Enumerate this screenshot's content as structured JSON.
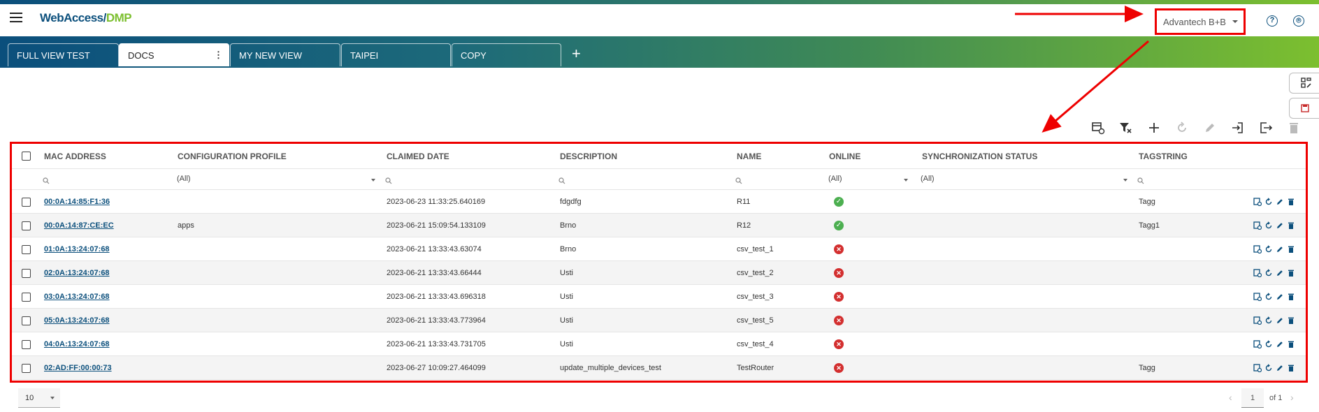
{
  "header": {
    "logo_part1": "WebAccess/",
    "logo_part2": "DMP",
    "org_selector": "Advantech B+B",
    "help_icon_glyph": "?",
    "user_icon_glyph": "⌾"
  },
  "tabs": [
    {
      "label": "FULL VIEW TEST"
    },
    {
      "label": "DOCS",
      "active": true
    },
    {
      "label": "MY NEW VIEW"
    },
    {
      "label": "TAIPEI"
    },
    {
      "label": "COPY"
    }
  ],
  "tab_add": "+",
  "tab_menu": "⋮",
  "columns": [
    "MAC ADDRESS",
    "CONFIGURATION PROFILE",
    "CLAIMED DATE",
    "DESCRIPTION",
    "NAME",
    "ONLINE",
    "SYNCHRONIZATION STATUS",
    "TAGSTRING"
  ],
  "filters": {
    "profile": "(All)",
    "online": "(All)",
    "sync": "(All)"
  },
  "rows": [
    {
      "mac": "00:0A:14:85:F1:36",
      "profile": "",
      "claimed": "2023-06-23 11:33:25.640169",
      "description": "fdgdfg",
      "name": "R11",
      "online": true,
      "sync": "",
      "tag": "Tagg"
    },
    {
      "mac": "00:0A:14:87:CE:EC",
      "profile": "apps",
      "claimed": "2023-06-21 15:09:54.133109",
      "description": "Brno",
      "name": "R12",
      "online": true,
      "sync": "",
      "tag": "Tagg1"
    },
    {
      "mac": "01:0A:13:24:07:68",
      "profile": "",
      "claimed": "2023-06-21 13:33:43.63074",
      "description": "Brno",
      "name": "csv_test_1",
      "online": false,
      "sync": "",
      "tag": ""
    },
    {
      "mac": "02:0A:13:24:07:68",
      "profile": "",
      "claimed": "2023-06-21 13:33:43.66444",
      "description": "Usti",
      "name": "csv_test_2",
      "online": false,
      "sync": "",
      "tag": ""
    },
    {
      "mac": "03:0A:13:24:07:68",
      "profile": "",
      "claimed": "2023-06-21 13:33:43.696318",
      "description": "Usti",
      "name": "csv_test_3",
      "online": false,
      "sync": "",
      "tag": ""
    },
    {
      "mac": "05:0A:13:24:07:68",
      "profile": "",
      "claimed": "2023-06-21 13:33:43.773964",
      "description": "Usti",
      "name": "csv_test_5",
      "online": false,
      "sync": "",
      "tag": ""
    },
    {
      "mac": "04:0A:13:24:07:68",
      "profile": "",
      "claimed": "2023-06-21 13:33:43.731705",
      "description": "Usti",
      "name": "csv_test_4",
      "online": false,
      "sync": "",
      "tag": ""
    },
    {
      "mac": "02:AD:FF:00:00:73",
      "profile": "",
      "claimed": "2023-06-27 10:09:27.464099",
      "description": "update_multiple_devices_test",
      "name": "TestRouter",
      "online": false,
      "sync": "",
      "tag": "Tagg"
    }
  ],
  "pager": {
    "page_size": "10",
    "page": "1",
    "of_label": "of 1"
  },
  "colors": {
    "brand_blue": "#0b4f7c",
    "brand_green": "#7cbf2f",
    "highlight_red": "#e00",
    "online": "#4caf50",
    "offline": "#d32f2f"
  }
}
